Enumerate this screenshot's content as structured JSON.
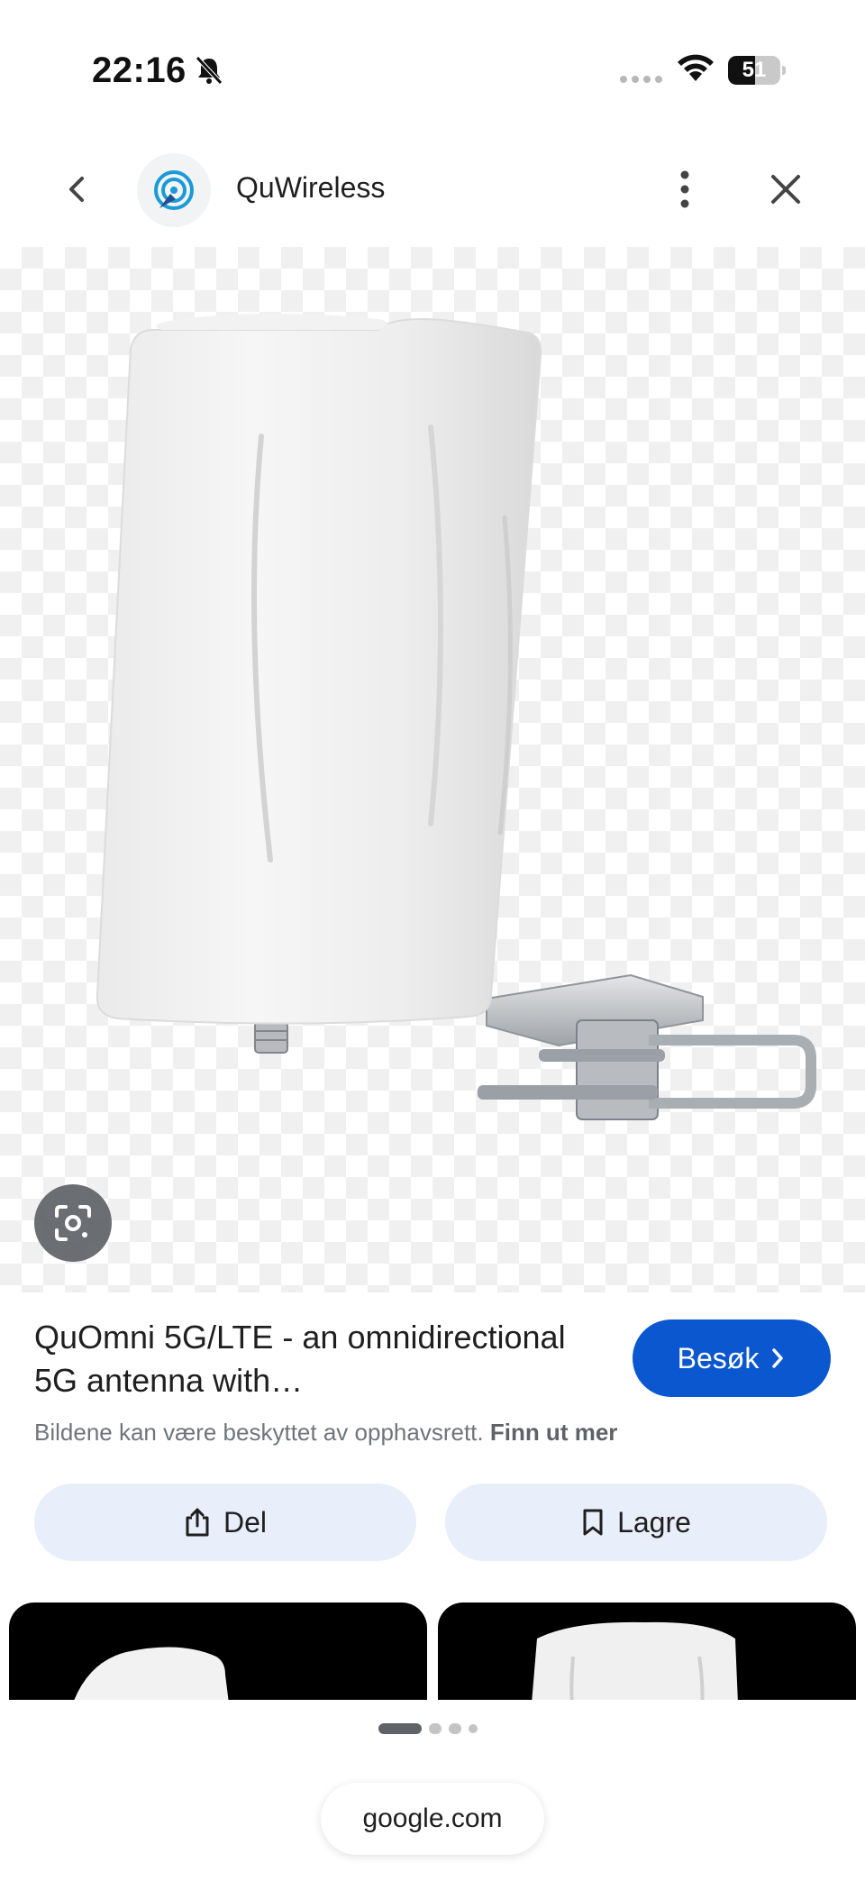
{
  "status_bar": {
    "time": "22:16",
    "battery_level": "51",
    "icons": [
      "bell-slash-icon",
      "signal-dots-icon",
      "wifi-icon",
      "battery-icon"
    ]
  },
  "header": {
    "site_name": "QuWireless",
    "icons": [
      "back-arrow-icon",
      "site-logo-icon",
      "more-vert-icon",
      "close-icon"
    ]
  },
  "result": {
    "title": "QuOmni 5G/LTE - an omnidirectional 5G antenna with…",
    "visit_label": "Besøk",
    "copyright_text": "Bildene kan være beskyttet av opphavsrett. ",
    "learn_more": "Finn ut mer"
  },
  "actions": {
    "share_label": "Del",
    "save_label": "Lagre"
  },
  "pager": {
    "current_page": 1,
    "total_pages": 4
  },
  "address_bar": {
    "domain": "google.com"
  },
  "colors": {
    "accent": "#0b57d0",
    "action_bg": "#e8eefa",
    "thumb_bg": "#000000"
  }
}
